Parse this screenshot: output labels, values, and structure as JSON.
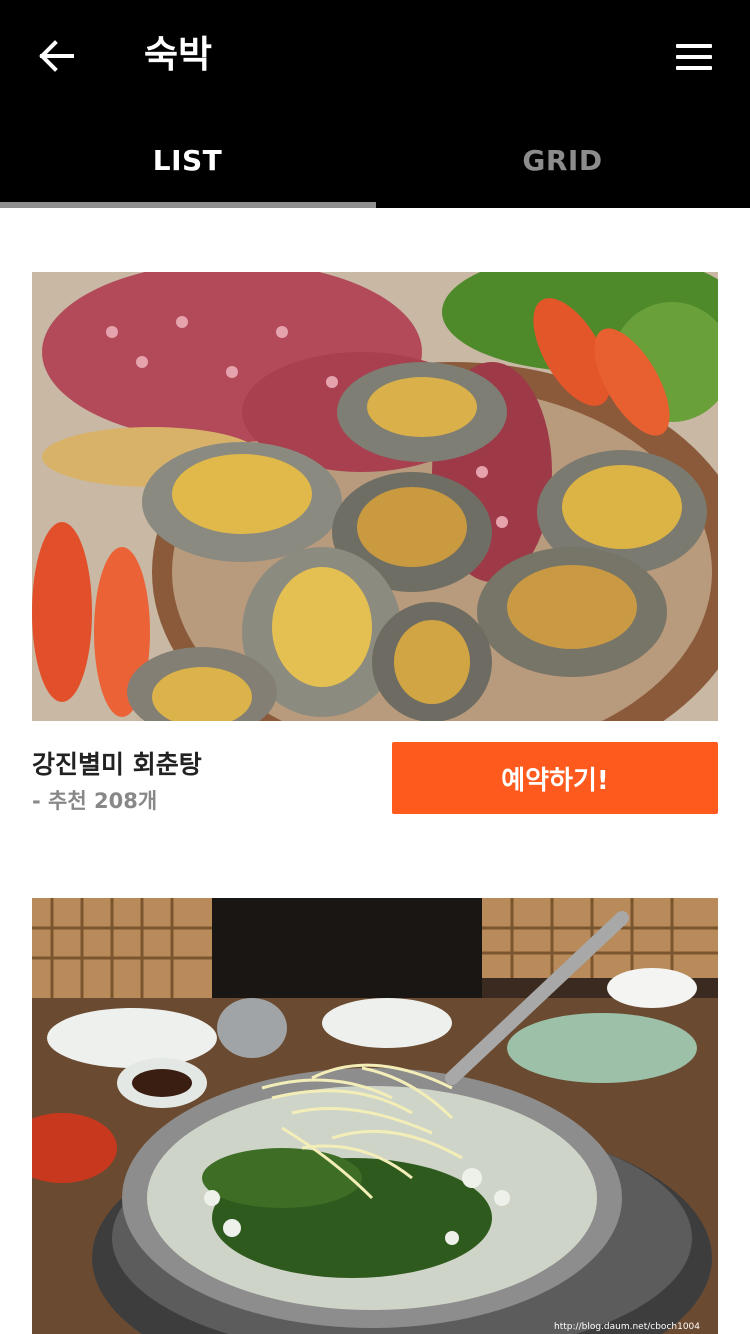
{
  "header": {
    "title": "숙박",
    "back_icon": "arrow-left-icon",
    "menu_icon": "hamburger-menu-icon"
  },
  "tabs": [
    {
      "label": "LIST",
      "active": true
    },
    {
      "label": "GRID",
      "active": false
    }
  ],
  "listings": [
    {
      "name": "강진별미 회춘탕",
      "recommend": "- 추천 208개",
      "book_label": "예약하기!",
      "image": "seafood-platter-octopus-abalone-shrimp"
    },
    {
      "image": "pot-stew-bean-sprouts-greens",
      "watermark": "http://blog.daum.net/cboch1004"
    }
  ],
  "colors": {
    "header_bg": "#000000",
    "accent": "#ff5a1e",
    "tab_indicator": "#8f8f8f",
    "inactive_tab": "#8c8c8c"
  }
}
